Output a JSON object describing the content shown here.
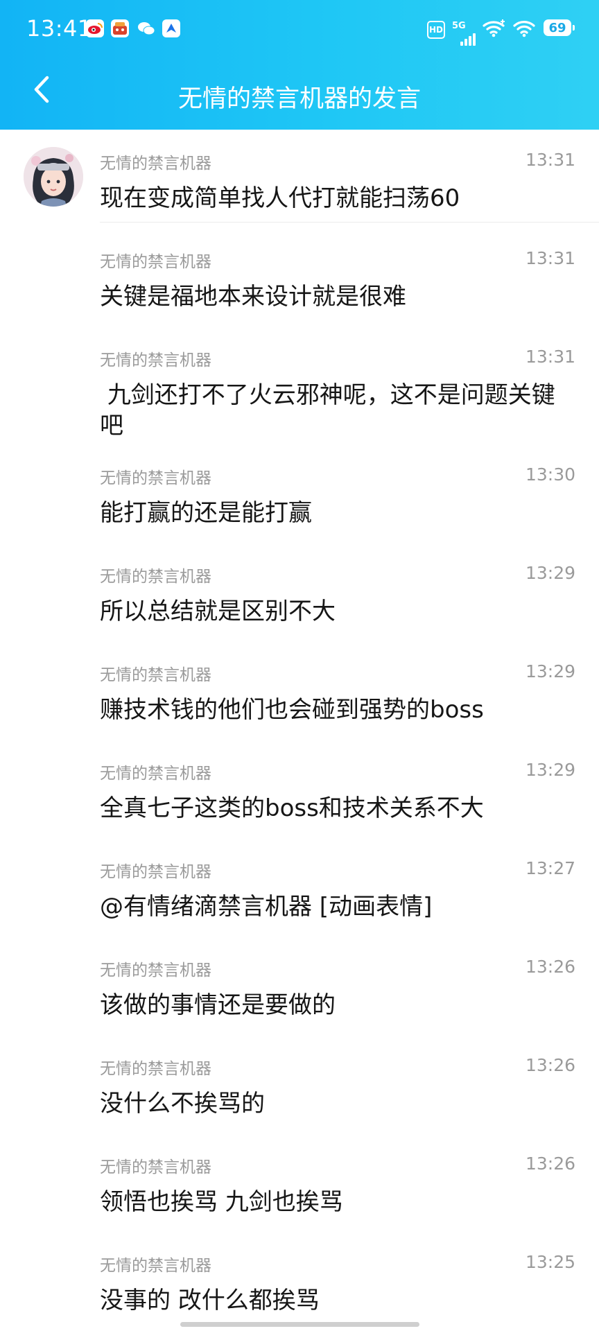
{
  "status_bar": {
    "time": "13:41",
    "network": "5G",
    "hd": "HD",
    "battery": "69"
  },
  "header": {
    "title": "无情的禁言机器的发言"
  },
  "messages": [
    {
      "user": "无情的禁言机器",
      "time": "13:31",
      "text": "现在变成简单找人代打就能扫荡60"
    },
    {
      "user": "无情的禁言机器",
      "time": "13:31",
      "text": "关键是福地本来设计就是很难"
    },
    {
      "user": "无情的禁言机器",
      "time": "13:31",
      "text": " 九剑还打不了火云邪神呢，这不是问题关键吧"
    },
    {
      "user": "无情的禁言机器",
      "time": "13:30",
      "text": "能打赢的还是能打赢"
    },
    {
      "user": "无情的禁言机器",
      "time": "13:29",
      "text": "所以总结就是区别不大"
    },
    {
      "user": "无情的禁言机器",
      "time": "13:29",
      "text": "赚技术钱的他们也会碰到强势的boss"
    },
    {
      "user": "无情的禁言机器",
      "time": "13:29",
      "text": "全真七子这类的boss和技术关系不大"
    },
    {
      "user": "无情的禁言机器",
      "time": "13:27",
      "text": "@有情绪滴禁言机器 [动画表情]"
    },
    {
      "user": "无情的禁言机器",
      "time": "13:26",
      "text": "该做的事情还是要做的"
    },
    {
      "user": "无情的禁言机器",
      "time": "13:26",
      "text": "没什么不挨骂的"
    },
    {
      "user": "无情的禁言机器",
      "time": "13:26",
      "text": "领悟也挨骂 九剑也挨骂"
    },
    {
      "user": "无情的禁言机器",
      "time": "13:25",
      "text": "没事的 改什么都挨骂"
    }
  ]
}
